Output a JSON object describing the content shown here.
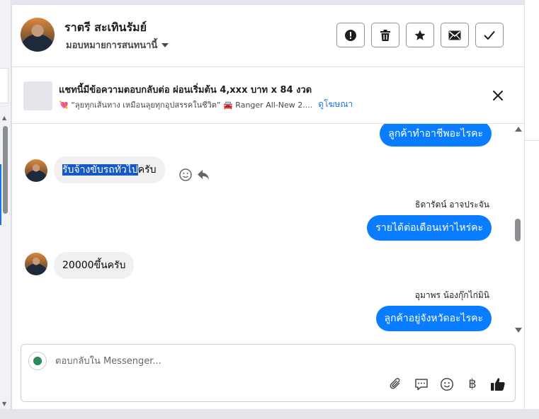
{
  "header": {
    "contact_name": "ราตรี สะเทินรัมย์",
    "assign_label": "มอบหมายการสนทนานี้",
    "actions": [
      "report-icon",
      "trash-icon",
      "star-icon",
      "envelope-icon",
      "check-icon"
    ]
  },
  "ad": {
    "title": "แชทนี้มีข้อความตอบกลับต่อ ผ่อนเริ่มต้น 4,xxx บาท x 84 งวด",
    "subtitle": "💘 “ลุยทุกเส้นทาง เหมือนลุยทุกอุปสรรคในชีวิต” 🚘 Ranger All-New 2....",
    "link_label": "ดูโฆษณา"
  },
  "messages": {
    "m1": {
      "text": "ลูกค้าทำอาชีพอะไรคะ"
    },
    "m2": {
      "highlighted": "รับจ้างขับรถทั่วไป",
      "rest": "ครับ"
    },
    "m3": {
      "sender": "ธิดารัตน์ อาจประจัน",
      "text": "รายได้ต่อเดือนเท่าไหร่คะ"
    },
    "m4": {
      "text": "20000ขึ้นครับ"
    },
    "m5": {
      "sender": "อุมาพร น้องกุ๊กไก่มินิ",
      "text": "ลูกค้าอยู่จังหวัดอะไรคะ"
    }
  },
  "composer": {
    "placeholder": "ตอบกลับใน Messenger...",
    "tools": [
      "paperclip-icon",
      "saved-reply-icon",
      "emoji-icon",
      "baht-icon",
      "like-icon"
    ],
    "baht_symbol": "฿"
  },
  "colors": {
    "outgoing_bubble": "#0a7cff",
    "incoming_bubble": "#f0f0f0",
    "selection_highlight": "#1559c8",
    "link": "#1b74e4"
  }
}
